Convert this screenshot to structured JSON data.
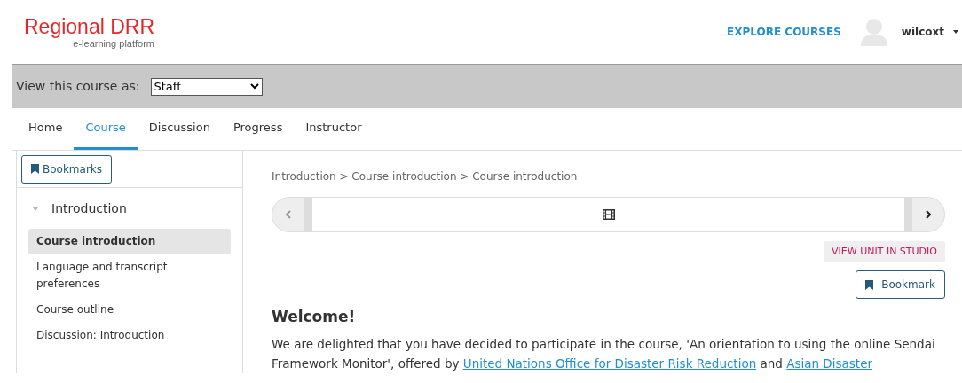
{
  "header": {
    "logo_title": "Regional DRR",
    "logo_subtitle": "e-learning platform",
    "explore": "EXPLORE COURSES",
    "username": "wilcoxt"
  },
  "view_as": {
    "label": "View this course as:",
    "value": "Staff"
  },
  "tabs": [
    {
      "label": "Home",
      "selected": false
    },
    {
      "label": "Course",
      "selected": true
    },
    {
      "label": "Discussion",
      "selected": false
    },
    {
      "label": "Progress",
      "selected": false
    },
    {
      "label": "Instructor",
      "selected": false
    }
  ],
  "sidebar": {
    "bookmarks": "Bookmarks",
    "section": {
      "title": "Introduction",
      "expanded": true,
      "items": [
        {
          "label": "Course introduction",
          "selected": true
        },
        {
          "label": "Language and transcript preferences",
          "selected": false
        },
        {
          "label": "Course outline",
          "selected": false
        },
        {
          "label": "Discussion: Introduction",
          "selected": false
        }
      ]
    }
  },
  "main": {
    "breadcrumb": "Introduction > Course introduction > Course introduction",
    "studio": "VIEW UNIT IN STUDIO",
    "bookmark": "Bookmark",
    "heading": "Welcome!",
    "paragraph": [
      {
        "kind": "text",
        "text": "We are delighted that you have decided to participate in the course, 'An orientation to using the online Sendai Framework Monitor', offered by "
      },
      {
        "kind": "link",
        "text": "United Nations Office for Disaster Risk Reduction"
      },
      {
        "kind": "text",
        "text": " and "
      },
      {
        "kind": "link",
        "text": "Asian Disaster"
      }
    ]
  }
}
